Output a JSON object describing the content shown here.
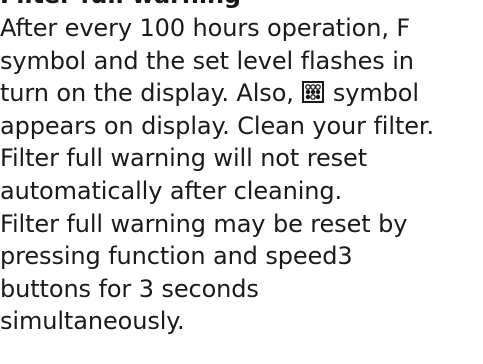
{
  "heading": "Filter full warning",
  "lines": {
    "l1": "After every 100 hours operation, F",
    "l2": "symbol and the set level flashes in",
    "l3a": "turn on the display. Also,",
    "l3b": "symbol",
    "l4": "appears on display. Clean your filter.",
    "l5": "Filter full warning will not reset",
    "l6": "automatically after cleaning.",
    "l7": "Filter full warning may be reset by",
    "l8": "pressing function and speed3",
    "l9": "buttons for 3 seconds",
    "l10": "simultaneously."
  },
  "icons": {
    "filter_symbol": "filter-grid-icon"
  }
}
